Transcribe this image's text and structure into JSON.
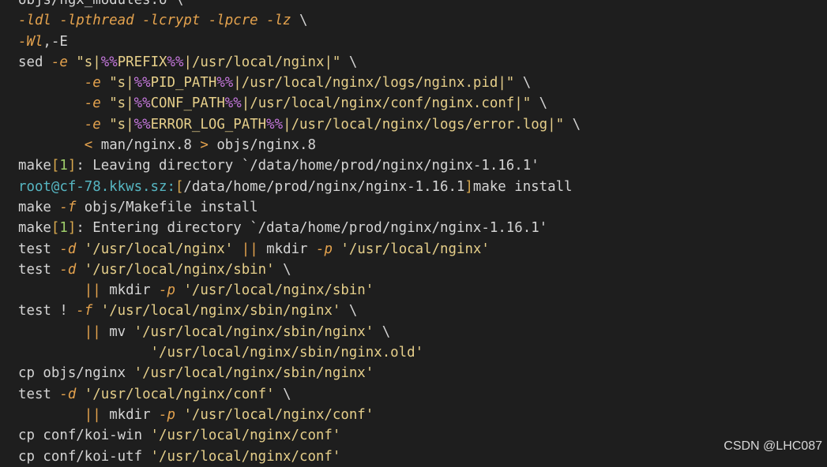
{
  "watermark": "CSDN @LHC087",
  "lines": [
    {
      "segs": [
        [
          "plain",
          "objs/ngx_modules.o \\"
        ]
      ]
    },
    {
      "segs": [
        [
          "flag",
          "-ldl -lpthread -lcrypt -lpcre -lz"
        ],
        [
          "plain",
          " \\"
        ]
      ]
    },
    {
      "segs": [
        [
          "flag",
          "-Wl"
        ],
        [
          "plain",
          ",-E"
        ]
      ]
    },
    {
      "segs": [
        [
          "plain",
          "sed "
        ],
        [
          "flag",
          "-e"
        ],
        [
          "str",
          " \"s|"
        ],
        [
          "pct",
          "%%"
        ],
        [
          "str",
          "PREFIX"
        ],
        [
          "pct",
          "%%"
        ],
        [
          "str",
          "|/usr/local/nginx|\""
        ],
        [
          "plain",
          " \\"
        ]
      ]
    },
    {
      "segs": [
        [
          "plain",
          "        "
        ],
        [
          "flag",
          "-e"
        ],
        [
          "str",
          " \"s|"
        ],
        [
          "pct",
          "%%"
        ],
        [
          "str",
          "PID_PATH"
        ],
        [
          "pct",
          "%%"
        ],
        [
          "str",
          "|/usr/local/nginx/logs/nginx.pid|\""
        ],
        [
          "plain",
          " \\"
        ]
      ]
    },
    {
      "segs": [
        [
          "plain",
          "        "
        ],
        [
          "flag",
          "-e"
        ],
        [
          "str",
          " \"s|"
        ],
        [
          "pct",
          "%%"
        ],
        [
          "str",
          "CONF_PATH"
        ],
        [
          "pct",
          "%%"
        ],
        [
          "str",
          "|/usr/local/nginx/conf/nginx.conf|\""
        ],
        [
          "plain",
          " \\"
        ]
      ]
    },
    {
      "segs": [
        [
          "plain",
          "        "
        ],
        [
          "flag",
          "-e"
        ],
        [
          "str",
          " \"s|"
        ],
        [
          "pct",
          "%%"
        ],
        [
          "str",
          "ERROR_LOG_PATH"
        ],
        [
          "pct",
          "%%"
        ],
        [
          "str",
          "|/usr/local/nginx/logs/error.log|\""
        ],
        [
          "plain",
          " \\"
        ]
      ]
    },
    {
      "segs": [
        [
          "plain",
          "        "
        ],
        [
          "op",
          "<"
        ],
        [
          "plain",
          " man/nginx.8 "
        ],
        [
          "op",
          ">"
        ],
        [
          "plain",
          " objs/nginx.8"
        ]
      ]
    },
    {
      "segs": [
        [
          "plain",
          "make"
        ],
        [
          "bracket",
          "["
        ],
        [
          "num",
          "1"
        ],
        [
          "bracket",
          "]"
        ],
        [
          "plain",
          ": Leaving directory `/data/home/prod/nginx/nginx-1.16.1'"
        ]
      ]
    },
    {
      "segs": [
        [
          "cyan",
          "root@cf-78.kkws.sz:"
        ],
        [
          "bracket",
          "["
        ],
        [
          "plain",
          "/data/home/prod/nginx/nginx-1.16.1"
        ],
        [
          "bracket",
          "]"
        ],
        [
          "plain",
          "make install"
        ]
      ]
    },
    {
      "segs": [
        [
          "plain",
          "make "
        ],
        [
          "flag",
          "-f"
        ],
        [
          "plain",
          " objs/Makefile install"
        ]
      ]
    },
    {
      "segs": [
        [
          "plain",
          "make"
        ],
        [
          "bracket",
          "["
        ],
        [
          "num",
          "1"
        ],
        [
          "bracket",
          "]"
        ],
        [
          "plain",
          ": Entering directory `/data/home/prod/nginx/nginx-1.16.1'"
        ]
      ]
    },
    {
      "segs": [
        [
          "plain",
          "test "
        ],
        [
          "flag",
          "-d"
        ],
        [
          "str",
          " '/usr/local/nginx'"
        ],
        [
          "plain",
          " "
        ],
        [
          "op",
          "||"
        ],
        [
          "plain",
          " mkdir "
        ],
        [
          "flag",
          "-p"
        ],
        [
          "str",
          " '/usr/local/nginx'"
        ]
      ]
    },
    {
      "segs": [
        [
          "plain",
          "test "
        ],
        [
          "flag",
          "-d"
        ],
        [
          "str",
          " '/usr/local/nginx/sbin'"
        ],
        [
          "plain",
          " \\"
        ]
      ]
    },
    {
      "segs": [
        [
          "plain",
          "        "
        ],
        [
          "op",
          "||"
        ],
        [
          "plain",
          " mkdir "
        ],
        [
          "flag",
          "-p"
        ],
        [
          "str",
          " '/usr/local/nginx/sbin'"
        ]
      ]
    },
    {
      "segs": [
        [
          "plain",
          "test ! "
        ],
        [
          "flag",
          "-f"
        ],
        [
          "str",
          " '/usr/local/nginx/sbin/nginx'"
        ],
        [
          "plain",
          " \\"
        ]
      ]
    },
    {
      "segs": [
        [
          "plain",
          "        "
        ],
        [
          "op",
          "||"
        ],
        [
          "plain",
          " mv "
        ],
        [
          "str",
          "'/usr/local/nginx/sbin/nginx'"
        ],
        [
          "plain",
          " \\"
        ]
      ]
    },
    {
      "segs": [
        [
          "plain",
          "                "
        ],
        [
          "str",
          "'/usr/local/nginx/sbin/nginx.old'"
        ]
      ]
    },
    {
      "segs": [
        [
          "plain",
          "cp objs/nginx "
        ],
        [
          "str",
          "'/usr/local/nginx/sbin/nginx'"
        ]
      ]
    },
    {
      "segs": [
        [
          "plain",
          "test "
        ],
        [
          "flag",
          "-d"
        ],
        [
          "str",
          " '/usr/local/nginx/conf'"
        ],
        [
          "plain",
          " \\"
        ]
      ]
    },
    {
      "segs": [
        [
          "plain",
          "        "
        ],
        [
          "op",
          "||"
        ],
        [
          "plain",
          " mkdir "
        ],
        [
          "flag",
          "-p"
        ],
        [
          "str",
          " '/usr/local/nginx/conf'"
        ]
      ]
    },
    {
      "segs": [
        [
          "plain",
          "cp conf/koi-win "
        ],
        [
          "str",
          "'/usr/local/nginx/conf'"
        ]
      ]
    },
    {
      "segs": [
        [
          "plain",
          "cp conf/koi-utf "
        ],
        [
          "str",
          "'/usr/local/nginx/conf'"
        ]
      ]
    }
  ]
}
